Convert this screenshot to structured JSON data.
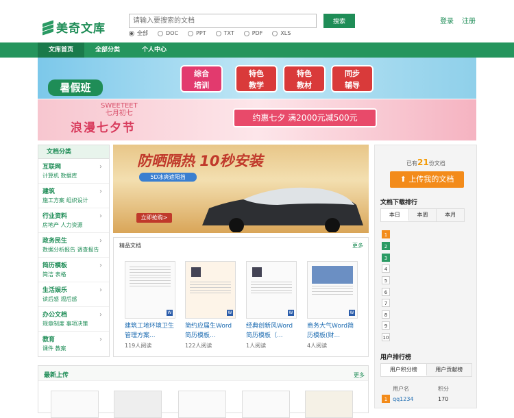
{
  "header": {
    "logo_text": "美奇文库",
    "search_placeholder": "请输入要搜索的文档",
    "search_button": "搜索",
    "login": "登录",
    "register": "注册",
    "file_types": [
      {
        "label": "全部",
        "selected": true
      },
      {
        "label": "DOC",
        "selected": false
      },
      {
        "label": "PPT",
        "selected": false
      },
      {
        "label": "TXT",
        "selected": false
      },
      {
        "label": "PDF",
        "selected": false
      },
      {
        "label": "XLS",
        "selected": false
      }
    ]
  },
  "nav": {
    "items": [
      "文库首页",
      "全部分类",
      "个人中心"
    ],
    "active_index": 0
  },
  "banner1": {
    "title": "暑假班",
    "tags": [
      "综合\n培训",
      "特色\n教学",
      "特色\n教材",
      "同步\n辅导"
    ]
  },
  "banner2": {
    "sub1": "SWEETEET",
    "sub2": "七月初七",
    "title": "浪漫七夕节",
    "offer": "约惠七夕 满2000元减500元"
  },
  "categories": {
    "title": "文档分类",
    "items": [
      {
        "name": "互联网",
        "sub": "计算机  数据库"
      },
      {
        "name": "建筑",
        "sub": "施工方案  组织设计"
      },
      {
        "name": "行业资料",
        "sub": "房地产  人力资源"
      },
      {
        "name": "政务民生",
        "sub": "数据分析报告  调查报告"
      },
      {
        "name": "简历模板",
        "sub": "简洁  表格"
      },
      {
        "name": "生活娱乐",
        "sub": "读后感  观后感"
      },
      {
        "name": "办公文档",
        "sub": "规章制度  事项决策"
      },
      {
        "name": "教育",
        "sub": "课件  教案"
      }
    ]
  },
  "promo": {
    "title": "防晒隔热 10秒安装",
    "subtitle": "5D冰爽遮阳挡",
    "button": "立即抢购>"
  },
  "featured": {
    "title": "精品文档",
    "more": "更多",
    "docs": [
      {
        "title": "建筑工地环境卫生管理方案...",
        "reads": "119人阅读"
      },
      {
        "title": "简约应届生Word简历模板...",
        "reads": "122人阅读"
      },
      {
        "title": "经典创新风Word简历模板（...",
        "reads": "1人阅读"
      },
      {
        "title": "商务大气Word简历模板(财...",
        "reads": "4人阅读"
      }
    ]
  },
  "latest": {
    "title": "最新上传",
    "more": "更多"
  },
  "sidebar": {
    "doc_count_prefix": "已有",
    "doc_count": "21",
    "doc_count_suffix": "份文档",
    "upload": "上传我的文档",
    "rank_title": "文档下载排行",
    "rank_tabs": [
      "本日",
      "本周",
      "本月"
    ],
    "ranks": [
      "1",
      "2",
      "3",
      "4",
      "5",
      "6",
      "7",
      "8",
      "9",
      "10"
    ],
    "user_rank_title": "用户排行榜",
    "user_tabs": [
      "用户积分榜",
      "用户贡献榜"
    ],
    "user_col1": "用户名",
    "user_col2": "积分",
    "users": [
      {
        "rank": "1",
        "name": "qq1234",
        "score": "170"
      }
    ]
  },
  "colors": {
    "brand": "#1f8d57",
    "nav": "#25955d",
    "upload": "#f38b1a"
  }
}
